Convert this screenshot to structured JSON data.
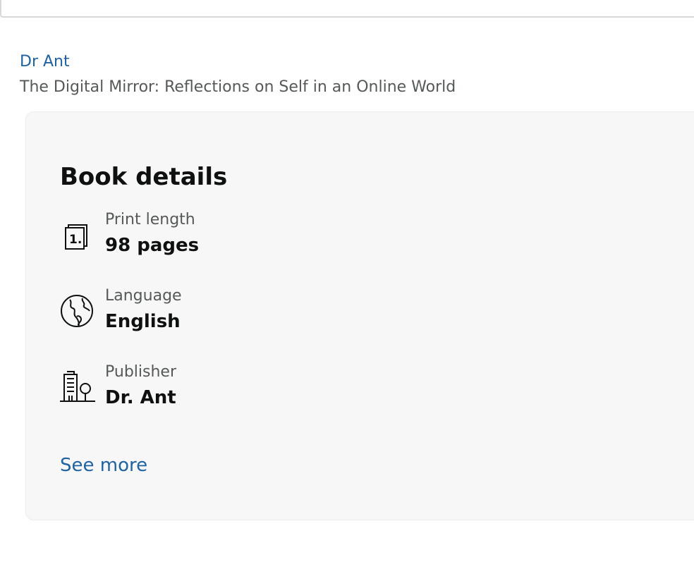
{
  "product": {
    "author": "Dr Ant",
    "title": "The Digital Mirror: Reflections on Self in an Online World"
  },
  "book_details": {
    "heading": "Book details",
    "items": [
      {
        "label": "Print length",
        "value": "98 pages",
        "icon": "pages-icon"
      },
      {
        "label": "Language",
        "value": "English",
        "icon": "globe-icon"
      },
      {
        "label": "Publisher",
        "value": "Dr. Ant",
        "icon": "building-icon"
      }
    ],
    "see_more_label": "See more"
  }
}
